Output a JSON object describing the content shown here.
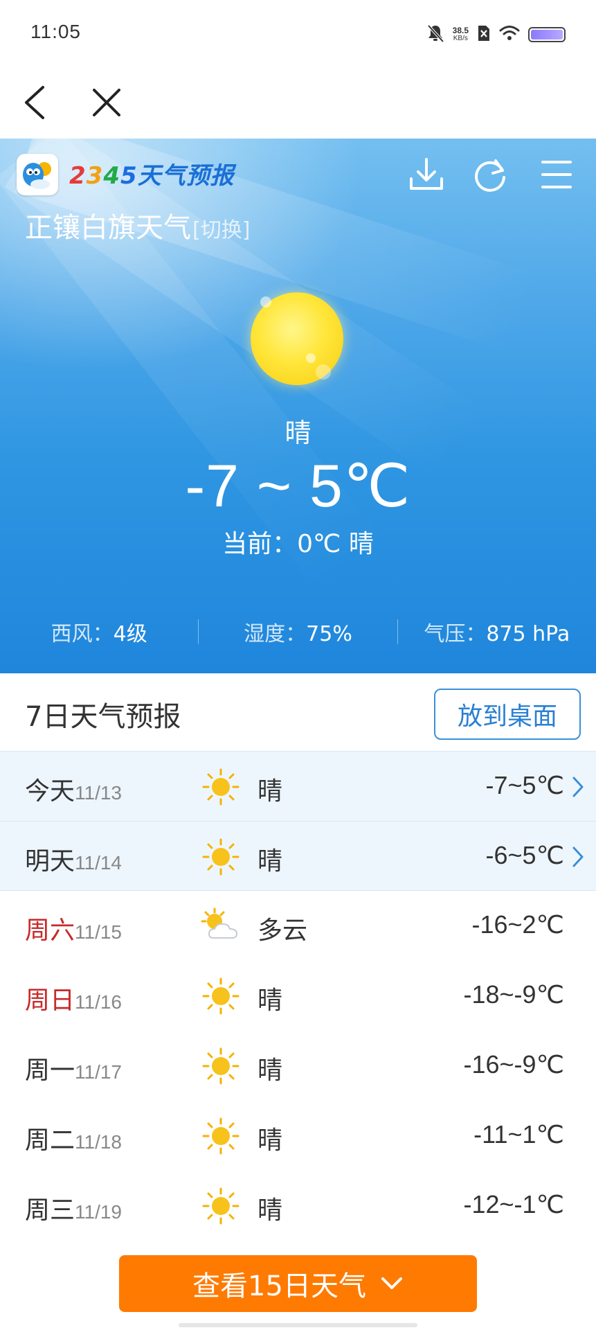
{
  "status_bar": {
    "time": "11:05",
    "net_speed_value": "38.5",
    "net_speed_unit": "KB/s"
  },
  "app": {
    "brand_name": "2345天气预报",
    "brand_digits": [
      "2",
      "3",
      "4",
      "5"
    ],
    "brand_suffix": "天气预报"
  },
  "city": {
    "name": "正镶白旗天气",
    "switch_label": "[切换]"
  },
  "today": {
    "condition": "晴",
    "temp_range": "-7 ~ 5℃",
    "current": "当前：0℃ 晴"
  },
  "stats": [
    {
      "label": "西风：",
      "value": "4级"
    },
    {
      "label": "湿度：",
      "value": "75%"
    },
    {
      "label": "气压：",
      "value": "875 hPa"
    }
  ],
  "forecast": {
    "title": "7日天气预报",
    "desktop_button": "放到桌面",
    "days": [
      {
        "day": "今天",
        "date": "11/13",
        "icon": "sunny-icon",
        "condition": "晴",
        "temp": "-7~5℃"
      },
      {
        "day": "明天",
        "date": "11/14",
        "icon": "sunny-icon",
        "condition": "晴",
        "temp": "-6~5℃"
      },
      {
        "day": "周六",
        "date": "11/15",
        "icon": "partly-cloudy-icon",
        "condition": "多云",
        "temp": "-16~2℃"
      },
      {
        "day": "周日",
        "date": "11/16",
        "icon": "sunny-icon",
        "condition": "晴",
        "temp": "-18~-9℃"
      },
      {
        "day": "周一",
        "date": "11/17",
        "icon": "sunny-icon",
        "condition": "晴",
        "temp": "-16~-9℃"
      },
      {
        "day": "周二",
        "date": "11/18",
        "icon": "sunny-icon",
        "condition": "晴",
        "temp": "-11~1℃"
      },
      {
        "day": "周三",
        "date": "11/19",
        "icon": "sunny-icon",
        "condition": "晴",
        "temp": "-12~-1℃"
      }
    ]
  },
  "more_button": "查看15日天气",
  "colors": {
    "accent_orange": "#ff7a00",
    "accent_blue": "#2a7fd2",
    "weekend_red": "#c82a2a",
    "sky_blue": "#2f96e2"
  }
}
